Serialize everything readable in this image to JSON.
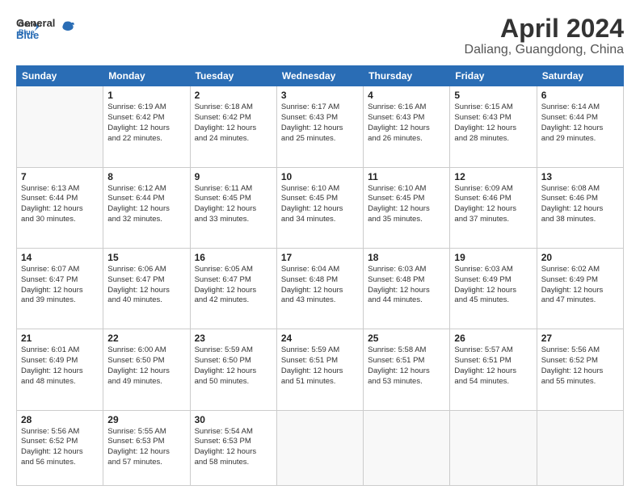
{
  "header": {
    "logo": {
      "line1": "General",
      "line2": "Blue"
    },
    "title": "April 2024",
    "subtitle": "Daliang, Guangdong, China"
  },
  "calendar": {
    "days_of_week": [
      "Sunday",
      "Monday",
      "Tuesday",
      "Wednesday",
      "Thursday",
      "Friday",
      "Saturday"
    ],
    "weeks": [
      [
        {
          "num": "",
          "info": ""
        },
        {
          "num": "1",
          "info": "Sunrise: 6:19 AM\nSunset: 6:42 PM\nDaylight: 12 hours\nand 22 minutes."
        },
        {
          "num": "2",
          "info": "Sunrise: 6:18 AM\nSunset: 6:42 PM\nDaylight: 12 hours\nand 24 minutes."
        },
        {
          "num": "3",
          "info": "Sunrise: 6:17 AM\nSunset: 6:43 PM\nDaylight: 12 hours\nand 25 minutes."
        },
        {
          "num": "4",
          "info": "Sunrise: 6:16 AM\nSunset: 6:43 PM\nDaylight: 12 hours\nand 26 minutes."
        },
        {
          "num": "5",
          "info": "Sunrise: 6:15 AM\nSunset: 6:43 PM\nDaylight: 12 hours\nand 28 minutes."
        },
        {
          "num": "6",
          "info": "Sunrise: 6:14 AM\nSunset: 6:44 PM\nDaylight: 12 hours\nand 29 minutes."
        }
      ],
      [
        {
          "num": "7",
          "info": "Sunrise: 6:13 AM\nSunset: 6:44 PM\nDaylight: 12 hours\nand 30 minutes."
        },
        {
          "num": "8",
          "info": "Sunrise: 6:12 AM\nSunset: 6:44 PM\nDaylight: 12 hours\nand 32 minutes."
        },
        {
          "num": "9",
          "info": "Sunrise: 6:11 AM\nSunset: 6:45 PM\nDaylight: 12 hours\nand 33 minutes."
        },
        {
          "num": "10",
          "info": "Sunrise: 6:10 AM\nSunset: 6:45 PM\nDaylight: 12 hours\nand 34 minutes."
        },
        {
          "num": "11",
          "info": "Sunrise: 6:10 AM\nSunset: 6:45 PM\nDaylight: 12 hours\nand 35 minutes."
        },
        {
          "num": "12",
          "info": "Sunrise: 6:09 AM\nSunset: 6:46 PM\nDaylight: 12 hours\nand 37 minutes."
        },
        {
          "num": "13",
          "info": "Sunrise: 6:08 AM\nSunset: 6:46 PM\nDaylight: 12 hours\nand 38 minutes."
        }
      ],
      [
        {
          "num": "14",
          "info": "Sunrise: 6:07 AM\nSunset: 6:47 PM\nDaylight: 12 hours\nand 39 minutes."
        },
        {
          "num": "15",
          "info": "Sunrise: 6:06 AM\nSunset: 6:47 PM\nDaylight: 12 hours\nand 40 minutes."
        },
        {
          "num": "16",
          "info": "Sunrise: 6:05 AM\nSunset: 6:47 PM\nDaylight: 12 hours\nand 42 minutes."
        },
        {
          "num": "17",
          "info": "Sunrise: 6:04 AM\nSunset: 6:48 PM\nDaylight: 12 hours\nand 43 minutes."
        },
        {
          "num": "18",
          "info": "Sunrise: 6:03 AM\nSunset: 6:48 PM\nDaylight: 12 hours\nand 44 minutes."
        },
        {
          "num": "19",
          "info": "Sunrise: 6:03 AM\nSunset: 6:49 PM\nDaylight: 12 hours\nand 45 minutes."
        },
        {
          "num": "20",
          "info": "Sunrise: 6:02 AM\nSunset: 6:49 PM\nDaylight: 12 hours\nand 47 minutes."
        }
      ],
      [
        {
          "num": "21",
          "info": "Sunrise: 6:01 AM\nSunset: 6:49 PM\nDaylight: 12 hours\nand 48 minutes."
        },
        {
          "num": "22",
          "info": "Sunrise: 6:00 AM\nSunset: 6:50 PM\nDaylight: 12 hours\nand 49 minutes."
        },
        {
          "num": "23",
          "info": "Sunrise: 5:59 AM\nSunset: 6:50 PM\nDaylight: 12 hours\nand 50 minutes."
        },
        {
          "num": "24",
          "info": "Sunrise: 5:59 AM\nSunset: 6:51 PM\nDaylight: 12 hours\nand 51 minutes."
        },
        {
          "num": "25",
          "info": "Sunrise: 5:58 AM\nSunset: 6:51 PM\nDaylight: 12 hours\nand 53 minutes."
        },
        {
          "num": "26",
          "info": "Sunrise: 5:57 AM\nSunset: 6:51 PM\nDaylight: 12 hours\nand 54 minutes."
        },
        {
          "num": "27",
          "info": "Sunrise: 5:56 AM\nSunset: 6:52 PM\nDaylight: 12 hours\nand 55 minutes."
        }
      ],
      [
        {
          "num": "28",
          "info": "Sunrise: 5:56 AM\nSunset: 6:52 PM\nDaylight: 12 hours\nand 56 minutes."
        },
        {
          "num": "29",
          "info": "Sunrise: 5:55 AM\nSunset: 6:53 PM\nDaylight: 12 hours\nand 57 minutes."
        },
        {
          "num": "30",
          "info": "Sunrise: 5:54 AM\nSunset: 6:53 PM\nDaylight: 12 hours\nand 58 minutes."
        },
        {
          "num": "",
          "info": ""
        },
        {
          "num": "",
          "info": ""
        },
        {
          "num": "",
          "info": ""
        },
        {
          "num": "",
          "info": ""
        }
      ]
    ]
  }
}
